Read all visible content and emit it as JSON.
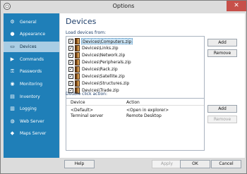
{
  "window": {
    "title": "Options",
    "close": "✕"
  },
  "sidebar": {
    "items": [
      {
        "label": "General",
        "icon": "gear-icon",
        "glyph": "⚙"
      },
      {
        "label": "Appearance",
        "icon": "palette-icon",
        "glyph": "●"
      },
      {
        "label": "Devices",
        "icon": "device-icon",
        "glyph": "▭"
      },
      {
        "label": "Commands",
        "icon": "command-icon",
        "glyph": "▶"
      },
      {
        "label": "Passwords",
        "icon": "key-icon",
        "glyph": "⚿"
      },
      {
        "label": "Monitoring",
        "icon": "monitor-icon",
        "glyph": "◉"
      },
      {
        "label": "Inventory",
        "icon": "inventory-icon",
        "glyph": "▤"
      },
      {
        "label": "Logging",
        "icon": "log-icon",
        "glyph": "▥"
      },
      {
        "label": "Web Server",
        "icon": "globe-icon",
        "glyph": "◍"
      },
      {
        "label": "Maps Server",
        "icon": "map-icon",
        "glyph": "◆"
      }
    ],
    "active_index": 2
  },
  "main": {
    "title": "Devices",
    "load_label": "Load devices from:",
    "devices": [
      "Devices\\Computers.zip",
      "Devices\\Links.zip",
      "Devices\\Network.zip",
      "Devices\\Peripherals.zip",
      "Devices\\Rack.zip",
      "Devices\\Satellite.zip",
      "Devices\\Structures.zip",
      "Devices\\Trade.zip"
    ],
    "device_checked": [
      true,
      true,
      true,
      true,
      true,
      true,
      true,
      true
    ],
    "check_glyph": "✓",
    "add_label": "Add",
    "remove_label": "Remove",
    "double_click_label": "Double click action:",
    "action_table": {
      "columns": [
        "Device",
        "Action"
      ],
      "rows": [
        [
          "<Default>",
          "<Open in explorer>"
        ],
        [
          "Terminal server",
          "Remote Desktop"
        ]
      ]
    },
    "add2_label": "Add",
    "remove2_label": "Remove"
  },
  "footer": {
    "help": "Help",
    "apply": "Apply",
    "ok": "OK",
    "cancel": "Cancel"
  }
}
